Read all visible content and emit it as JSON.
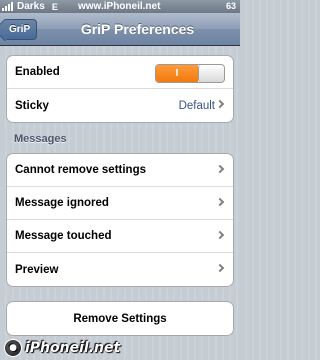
{
  "status_bar": {
    "carrier": "Darks",
    "network": "E",
    "site": "www.iPhoneil.net",
    "battery": "63"
  },
  "nav": {
    "back_label": "GriP",
    "title": "GriP Preferences"
  },
  "group1": {
    "enabled_label": "Enabled",
    "enabled_toggle_text": "I",
    "sticky_label": "Sticky",
    "sticky_value": "Default"
  },
  "messages_header": "Messages",
  "messages": [
    {
      "label": "Cannot remove settings"
    },
    {
      "label": "Message ignored"
    },
    {
      "label": "Message touched"
    },
    {
      "label": "Preview"
    }
  ],
  "remove_button_label": "Remove Settings",
  "watermark": {
    "text": "iPhoneil.net"
  },
  "colors": {
    "toggle_on": "#f27a0c",
    "value_text": "#385487",
    "section_header": "#4c566c"
  }
}
